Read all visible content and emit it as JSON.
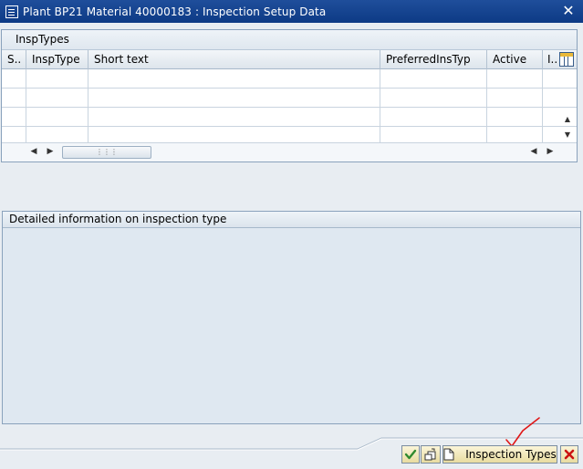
{
  "window": {
    "title": "Plant BP21 Material 40000183 : Inspection Setup Data",
    "close_glyph": "✕"
  },
  "insp_table": {
    "panel_title": "InspTypes",
    "columns": [
      "S..",
      "InspType",
      "Short text",
      "PreferredInsTyp",
      "Active",
      "I.."
    ],
    "rows": [
      [
        "",
        "",
        "",
        "",
        "",
        ""
      ],
      [
        "",
        "",
        "",
        "",
        "",
        ""
      ],
      [
        "",
        "",
        "",
        "",
        "",
        ""
      ],
      [
        "",
        "",
        "",
        "",
        "",
        ""
      ]
    ],
    "settings_icon": "table-settings-icon"
  },
  "detail_panel": {
    "title": "Detailed information on inspection type"
  },
  "footer": {
    "confirm_icon": "checkmark-icon",
    "copy_icon": "copy-icon",
    "new_icon": "new-document-icon",
    "inspection_types_label": "Inspection Types",
    "cancel_icon": "close-icon",
    "accent_colors": {
      "confirm": "#2f8a2f",
      "cancel": "#cc1111",
      "annotation": "#e01818"
    }
  }
}
